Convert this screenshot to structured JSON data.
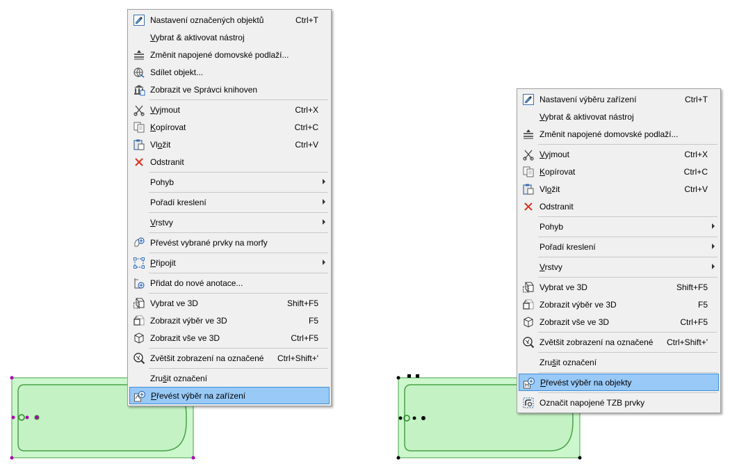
{
  "menu_left": {
    "items": [
      {
        "type": "item",
        "label": "Nastavení označených objektů",
        "shortcut": "Ctrl+T",
        "icon": "settings-icon"
      },
      {
        "type": "item",
        "label": "Vybrat & aktivovat nástroj",
        "shortcut": "",
        "icon": ""
      },
      {
        "type": "item",
        "label": "Změnit napojené domovské podlaží...",
        "shortcut": "",
        "icon": "story-icon"
      },
      {
        "type": "item",
        "label": "Sdílet objekt...",
        "shortcut": "",
        "icon": "share-globe-icon"
      },
      {
        "type": "item",
        "label": "Zobrazit ve Správci knihoven",
        "shortcut": "",
        "icon": "library-icon"
      },
      {
        "type": "sep"
      },
      {
        "type": "item",
        "label": "Vyjmout",
        "shortcut": "Ctrl+X",
        "icon": "scissors-icon"
      },
      {
        "type": "item",
        "label": "Kopírovat",
        "shortcut": "Ctrl+C",
        "icon": "copy-icon"
      },
      {
        "type": "item",
        "label": "Vložit",
        "shortcut": "Ctrl+V",
        "icon": "paste-icon"
      },
      {
        "type": "item",
        "label": "Odstranit",
        "shortcut": "",
        "icon": "delete-x-icon"
      },
      {
        "type": "sep"
      },
      {
        "type": "item",
        "label": "Pohyb",
        "shortcut": "",
        "icon": "",
        "submenu": true
      },
      {
        "type": "sep"
      },
      {
        "type": "item",
        "label": "Pořadí kreslení",
        "shortcut": "",
        "icon": "",
        "submenu": true
      },
      {
        "type": "sep"
      },
      {
        "type": "item",
        "label": "Vrstvy",
        "shortcut": "",
        "icon": "",
        "submenu": true
      },
      {
        "type": "sep"
      },
      {
        "type": "item",
        "label": "Převést vybrané prvky na morfy",
        "shortcut": "",
        "icon": "morph-icon"
      },
      {
        "type": "sep"
      },
      {
        "type": "item",
        "label": "Připojit",
        "shortcut": "",
        "icon": "connect-icon",
        "submenu": true
      },
      {
        "type": "sep"
      },
      {
        "type": "item",
        "label": "Přidat do nové anotace...",
        "shortcut": "",
        "icon": "annotation-add-icon"
      },
      {
        "type": "sep"
      },
      {
        "type": "item",
        "label": "Vybrat ve 3D",
        "shortcut": "Shift+F5",
        "icon": "cube-select-icon"
      },
      {
        "type": "item",
        "label": "Zobrazit výběr ve 3D",
        "shortcut": "F5",
        "icon": "cube-selection-icon"
      },
      {
        "type": "item",
        "label": "Zobrazit vše ve 3D",
        "shortcut": "Ctrl+F5",
        "icon": "cube-all-icon"
      },
      {
        "type": "sep"
      },
      {
        "type": "item",
        "label": "Zvětšit zobrazení na označené",
        "shortcut": "Ctrl+Shift+'",
        "icon": "zoom-selection-icon"
      },
      {
        "type": "sep"
      },
      {
        "type": "item",
        "label": "Zrušit označení",
        "shortcut": "",
        "icon": ""
      },
      {
        "type": "item",
        "label": "Převést výběr na zařízení",
        "shortcut": "",
        "icon": "convert-to-equipment-icon",
        "highlighted": true
      }
    ]
  },
  "menu_right": {
    "items": [
      {
        "type": "item",
        "label": "Nastavení výběru zařízení",
        "shortcut": "Ctrl+T",
        "icon": "settings-icon"
      },
      {
        "type": "item",
        "label": "Vybrat & aktivovat nástroj",
        "shortcut": "",
        "icon": ""
      },
      {
        "type": "item",
        "label": "Změnit napojené domovské podlaží...",
        "shortcut": "",
        "icon": "story-icon"
      },
      {
        "type": "sep"
      },
      {
        "type": "item",
        "label": "Vyjmout",
        "shortcut": "Ctrl+X",
        "icon": "scissors-icon"
      },
      {
        "type": "item",
        "label": "Kopírovat",
        "shortcut": "Ctrl+C",
        "icon": "copy-icon"
      },
      {
        "type": "item",
        "label": "Vložit",
        "shortcut": "Ctrl+V",
        "icon": "paste-icon"
      },
      {
        "type": "item",
        "label": "Odstranit",
        "shortcut": "",
        "icon": "delete-x-icon"
      },
      {
        "type": "sep"
      },
      {
        "type": "item",
        "label": "Pohyb",
        "shortcut": "",
        "icon": "",
        "submenu": true
      },
      {
        "type": "sep"
      },
      {
        "type": "item",
        "label": "Pořadí kreslení",
        "shortcut": "",
        "icon": "",
        "submenu": true
      },
      {
        "type": "sep"
      },
      {
        "type": "item",
        "label": "Vrstvy",
        "shortcut": "",
        "icon": "",
        "submenu": true
      },
      {
        "type": "sep"
      },
      {
        "type": "item",
        "label": "Vybrat ve 3D",
        "shortcut": "Shift+F5",
        "icon": "cube-select-icon"
      },
      {
        "type": "item",
        "label": "Zobrazit výběr ve 3D",
        "shortcut": "F5",
        "icon": "cube-selection-icon"
      },
      {
        "type": "item",
        "label": "Zobrazit vše ve 3D",
        "shortcut": "Ctrl+F5",
        "icon": "cube-all-icon"
      },
      {
        "type": "sep"
      },
      {
        "type": "item",
        "label": "Zvětšit zobrazení na označené",
        "shortcut": "Ctrl+Shift+'",
        "icon": "zoom-selection-icon"
      },
      {
        "type": "sep"
      },
      {
        "type": "item",
        "label": "Zrušit označení",
        "shortcut": "",
        "icon": ""
      },
      {
        "type": "sep"
      },
      {
        "type": "item",
        "label": "Převést výběr na objekty",
        "shortcut": "",
        "icon": "convert-to-objects-icon",
        "highlighted": true
      },
      {
        "type": "sep"
      },
      {
        "type": "item",
        "label": "Označit napojené TZB prvky",
        "shortcut": "",
        "icon": "mep-connected-icon"
      }
    ]
  },
  "colors": {
    "highlight": "#99c9f7",
    "highlight_border": "#3d8fd8",
    "tub_fill": "#ccf7cc",
    "tub_stroke": "#4aa04a",
    "handle_left": "#b000b0",
    "handle_right": "#000000"
  }
}
